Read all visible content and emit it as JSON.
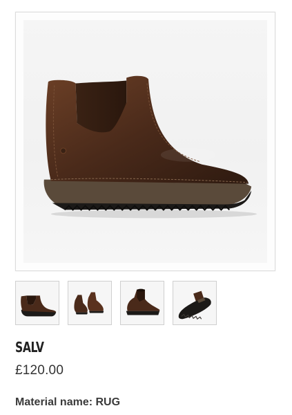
{
  "product": {
    "name": "SALV",
    "price": "£120.00",
    "material_label": "Material name: RUG"
  },
  "gallery": {
    "main_image": "brown-chelsea-boot-side-view",
    "thumbnails": [
      "boot-side-view",
      "boot-pair-view",
      "boot-angled-view",
      "boot-sole-view"
    ]
  },
  "colors": {
    "leather": "#4a2a1a",
    "sole": "#5a4a3a",
    "tread": "#1c1a18"
  }
}
